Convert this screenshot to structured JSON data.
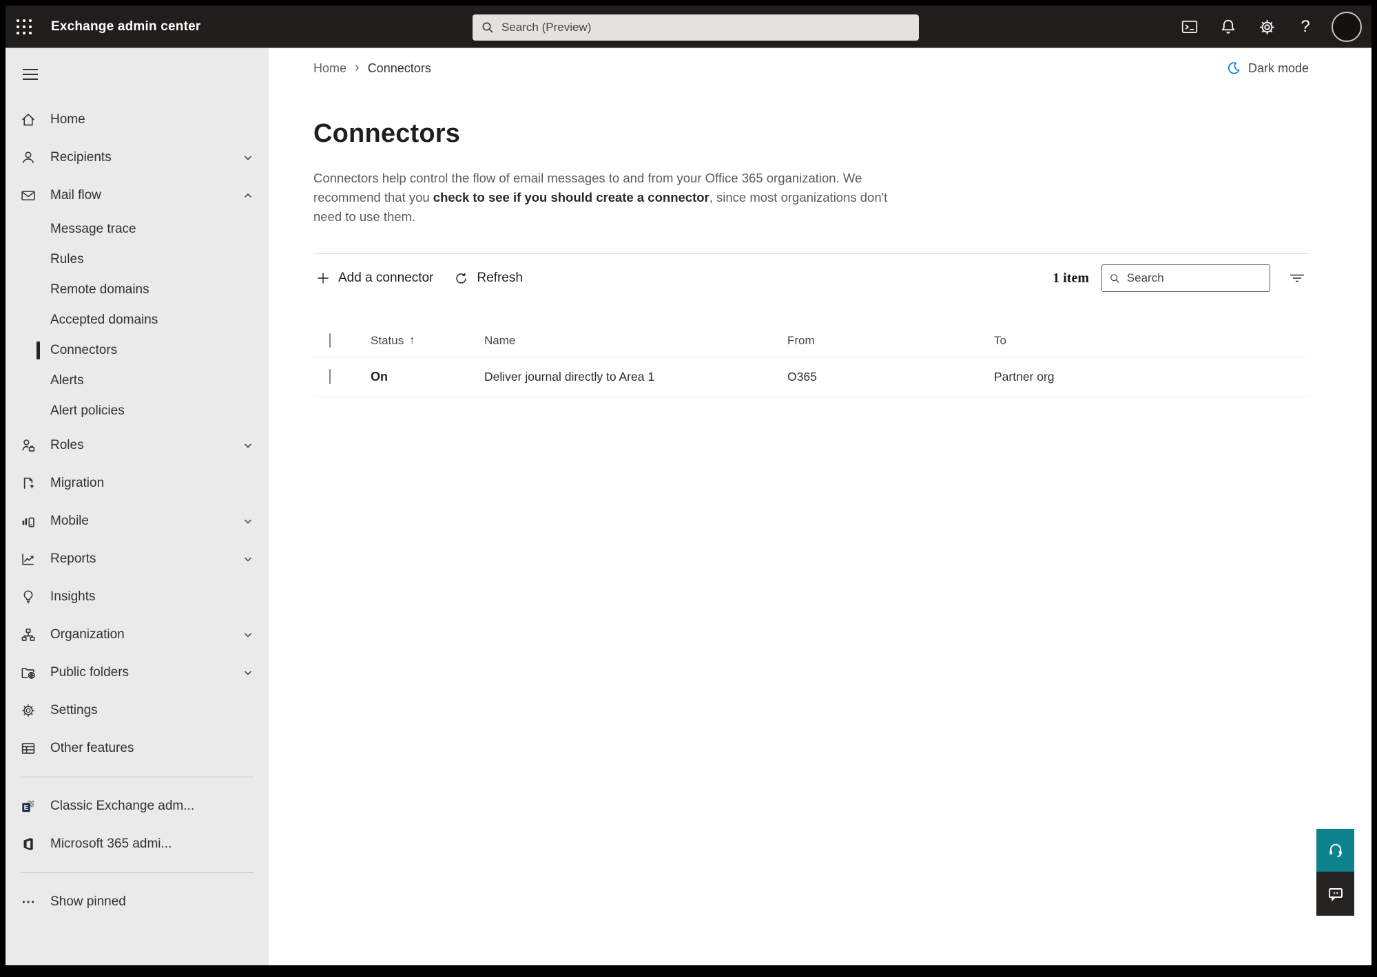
{
  "topbar": {
    "title": "Exchange admin center",
    "search_placeholder": "Search (Preview)",
    "help_glyph": "?"
  },
  "breadcrumb": {
    "home": "Home",
    "separator": "›",
    "current": "Connectors"
  },
  "dark_mode_label": "Dark mode",
  "page": {
    "title": "Connectors",
    "description_part1": "Connectors help control the flow of email messages to and from your Office 365 organization. We recommend that you ",
    "description_link": "check to see if you should create a connector",
    "description_part2": ", since most organizations don't need to use them."
  },
  "toolbar": {
    "add_label": "Add a connector",
    "refresh_label": "Refresh",
    "item_count": "1 item",
    "search_placeholder": "Search"
  },
  "table": {
    "headers": {
      "status": "Status",
      "name": "Name",
      "from": "From",
      "to": "To"
    },
    "sort_arrow": "↑",
    "rows": [
      {
        "status": "On",
        "name": "Deliver journal directly to Area 1",
        "from": "O365",
        "to": "Partner org"
      }
    ]
  },
  "sidebar": {
    "items": [
      {
        "label": "Home"
      },
      {
        "label": "Recipients"
      },
      {
        "label": "Mail flow"
      },
      {
        "label": "Message trace"
      },
      {
        "label": "Rules"
      },
      {
        "label": "Remote domains"
      },
      {
        "label": "Accepted domains"
      },
      {
        "label": "Connectors"
      },
      {
        "label": "Alerts"
      },
      {
        "label": "Alert policies"
      },
      {
        "label": "Roles"
      },
      {
        "label": "Migration"
      },
      {
        "label": "Mobile"
      },
      {
        "label": "Reports"
      },
      {
        "label": "Insights"
      },
      {
        "label": "Organization"
      },
      {
        "label": "Public folders"
      },
      {
        "label": "Settings"
      },
      {
        "label": "Other features"
      },
      {
        "label": "Classic Exchange adm..."
      },
      {
        "label": "Microsoft 365 admi..."
      },
      {
        "label": "Show pinned"
      }
    ]
  },
  "colors": {
    "topbar_bg": "#1f1e1d",
    "sidebar_bg": "#eaeaea",
    "accent_blue": "#0078d4",
    "help_teal": "#0e828c",
    "feedback_dark": "#252423"
  }
}
